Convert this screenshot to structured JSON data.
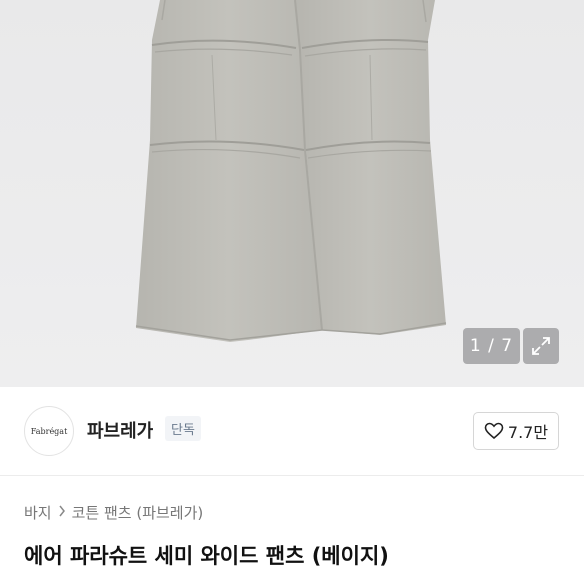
{
  "gallery": {
    "pager_text": "1 / 7",
    "expand_icon": "expand-icon"
  },
  "brand": {
    "logo_text": "Fabrégat",
    "name": "파브레가",
    "badge": "단독",
    "like_icon": "heart-icon",
    "like_count": "7.7만"
  },
  "breadcrumb": {
    "category": "바지",
    "separator_icon": "chevron-right-icon",
    "subcategory": "코튼 팬츠 (파브레가)"
  },
  "product": {
    "title": "에어 파라슈트 세미 와이드 팬츠 (베이지)"
  },
  "colors": {
    "pants": "#bdbcb6",
    "hero_bg": "#ebebec",
    "overlay": "#a0a0a2"
  }
}
